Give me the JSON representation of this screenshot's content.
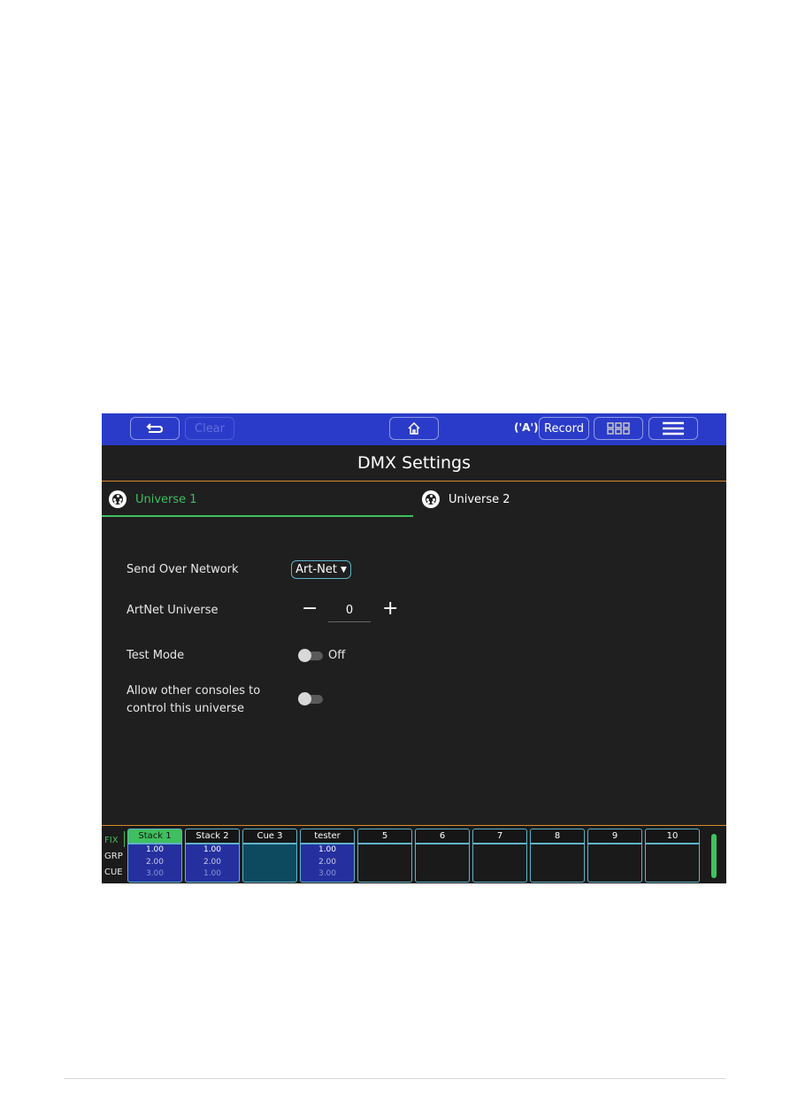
{
  "topbar": {
    "back_label": "",
    "clear_label": "Clear",
    "record_label": "Record",
    "colors": {
      "bar": "#2b3bc9",
      "accent_green": "#3fbf5f",
      "divider_orange": "#d98a2b"
    }
  },
  "page": {
    "title": "DMX Settings"
  },
  "tabs": [
    {
      "label": "Universe 1",
      "active": true
    },
    {
      "label": "Universe 2",
      "active": false
    }
  ],
  "settings": {
    "send_over_network": {
      "label": "Send Over Network",
      "value": "Art-Net"
    },
    "artnet_universe": {
      "label": "ArtNet Universe",
      "value": "0",
      "minus": "−",
      "plus": "+"
    },
    "test_mode": {
      "label": "Test Mode",
      "state": "Off"
    },
    "allow_other_consoles": {
      "label_line1": "Allow other consoles to",
      "label_line2": "control this universe",
      "state": "off"
    }
  },
  "playback": {
    "modes": [
      "FIX",
      "GRP",
      "CUE"
    ],
    "active_mode": "FIX",
    "slots": [
      {
        "name": "Stack 1",
        "values": [
          "1.00",
          "2.00",
          "3.00"
        ],
        "style": "blue",
        "active": true
      },
      {
        "name": "Stack 2",
        "values": [
          "1.00",
          "2.00",
          "1.00"
        ],
        "style": "blue",
        "active": false
      },
      {
        "name": "Cue 3",
        "values": [],
        "style": "teal",
        "active": false
      },
      {
        "name": "tester",
        "values": [
          "1.00",
          "2.00",
          "3.00"
        ],
        "style": "blue",
        "active": false
      },
      {
        "name": "5",
        "values": [],
        "style": "empty",
        "active": false
      },
      {
        "name": "6",
        "values": [],
        "style": "empty",
        "active": false
      },
      {
        "name": "7",
        "values": [],
        "style": "empty",
        "active": false
      },
      {
        "name": "8",
        "values": [],
        "style": "empty",
        "active": false
      },
      {
        "name": "9",
        "values": [],
        "style": "empty",
        "active": false
      },
      {
        "name": "10",
        "values": [],
        "style": "empty",
        "active": false
      }
    ]
  }
}
